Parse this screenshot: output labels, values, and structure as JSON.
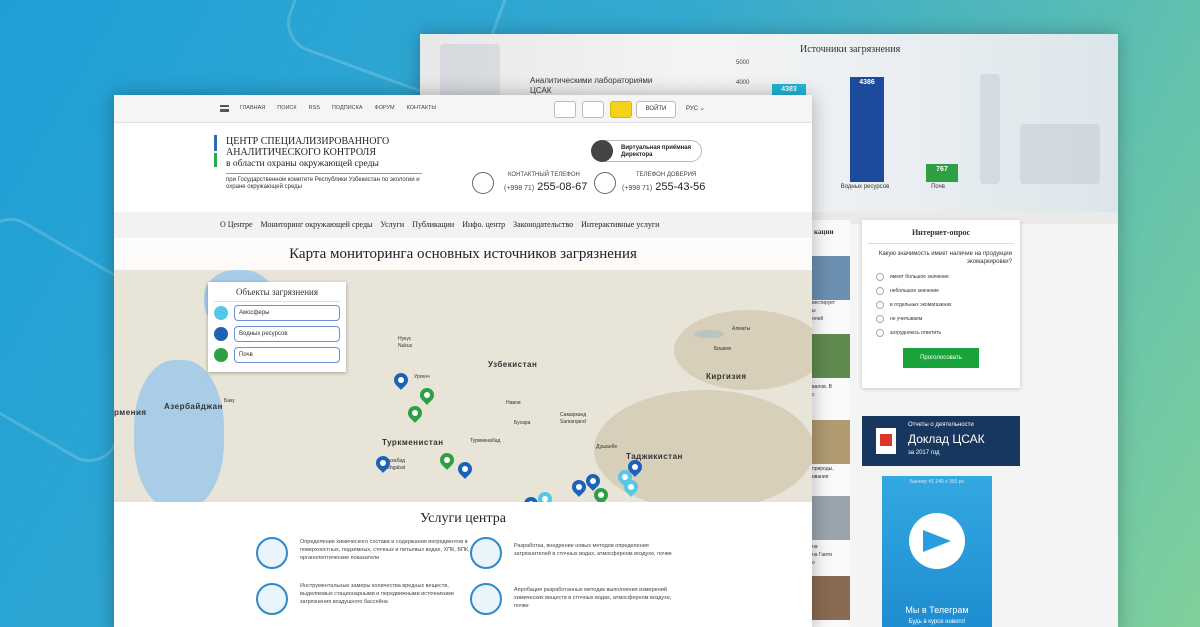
{
  "back_page": {
    "chart": {
      "title": "Источники загрязнения",
      "lab_label": "Аналитическими лабораториями ЦСАК"
    },
    "news_heading": "кации",
    "news_snippets": [
      "вестирует",
      "ы",
      "ялей",
      "валов. В",
      "с",
      "природы,",
      "ивания",
      "на",
      "на Гаити",
      "о"
    ],
    "poll": {
      "title": "Интернет-опрос",
      "question": "Какую значимость имеет наличие на продукции экомаркировки?",
      "options": [
        "имеет большое значение",
        "небольшое значение",
        "в отдельных экомагазинах",
        "не учитываем",
        "затрудняюсь ответить"
      ],
      "button": "Проголосовать"
    },
    "report": {
      "small": "Отчеты о деятельности",
      "big": "Доклад ЦСАК",
      "year": "за 2017 год"
    },
    "banner": {
      "caption": "Баннер #1 240 x 350 px",
      "name": "Мы в Телеграм",
      "sub": "Будь в курсе нового!"
    }
  },
  "chart_data": {
    "type": "bar",
    "title": "Источники загрязнения",
    "categories": [
      "",
      "Водных ресурсов",
      "Почв"
    ],
    "values": [
      4383,
      4386,
      767
    ],
    "value_labels": [
      "4383",
      "4386",
      "767"
    ],
    "colors": [
      "#1fb8d8",
      "#1c4a9c",
      "#2ea043"
    ],
    "y_ticks": [
      "4000",
      "5000"
    ],
    "ylim": [
      0,
      5000
    ]
  },
  "topbar": {
    "nav": [
      "ГЛАВНАЯ",
      "ПОИСК",
      "RSS",
      "ПОДПИСКА",
      "ФОРУМ",
      "КОНТАКТЫ"
    ],
    "login": "ВОЙТИ",
    "lang": "РУС"
  },
  "header": {
    "org_line1": "ЦЕНТР СПЕЦИАЛИЗИРОВАННОГО АНАЛИТИЧЕСКОГО КОНТРОЛЯ",
    "org_line2": "в области охраны окружающей среды",
    "org_sub": "при Государственном комитете Республики Узбекистан по экологии и охране окружающей среды",
    "reception": "Виртуальная приёмная Директора",
    "phone1": {
      "label": "КОНТАКТНЫЙ ТЕЛЕФОН",
      "code": "(+998 71)",
      "number": "255-08-67"
    },
    "phone2": {
      "label": "ТЕЛЕФОН ДОВЕРИЯ",
      "code": "(+998 71)",
      "number": "255-43-56"
    }
  },
  "mainnav": [
    "О Центре",
    "Мониторинг окружающей среды",
    "Услуги",
    "Публикации",
    "Инфо. центр",
    "Законодательство",
    "Интерактивные услуги"
  ],
  "map": {
    "title": "Карта мониторинга основных источников загрязнения",
    "legend": {
      "title": "Объекты загрязнения",
      "items": [
        "Амосферы",
        "Водных ресурсов",
        "Почв"
      ]
    },
    "regions": [
      "Узбекистан",
      "Киргизия",
      "Туркменистан",
      "Таджикистан",
      "Азербайджан",
      "рмения"
    ],
    "cities": [
      "Алматы",
      "Нукус",
      "Nukus",
      "Ургенч",
      "Самарканд",
      "Samarqand",
      "Душанбе",
      "Ашхабад",
      "Ashgabat",
      "Баку",
      "Бишкек",
      "Навои",
      "Бухара",
      "Туркменабад"
    ]
  },
  "services": {
    "title": "Услуги центра",
    "items": [
      "Определение химического состава и содержания ингредиентов в поверхностных, подземных, сточных и питьевых водах, ХПК, БПК, органолептические показатели",
      "Разработка, внедрение новых методов определения загрязнителей в сточных водах, атмосферном воздухе, почве",
      "Инструментальные замеры количества вредных веществ, выделяемых стационарными и передвижными источниками загрязнения воздушного бассейна",
      "Апробация разработанных методик выполнения измерений химических веществ в сточных водах, атмосферном воздухе, почве"
    ]
  }
}
